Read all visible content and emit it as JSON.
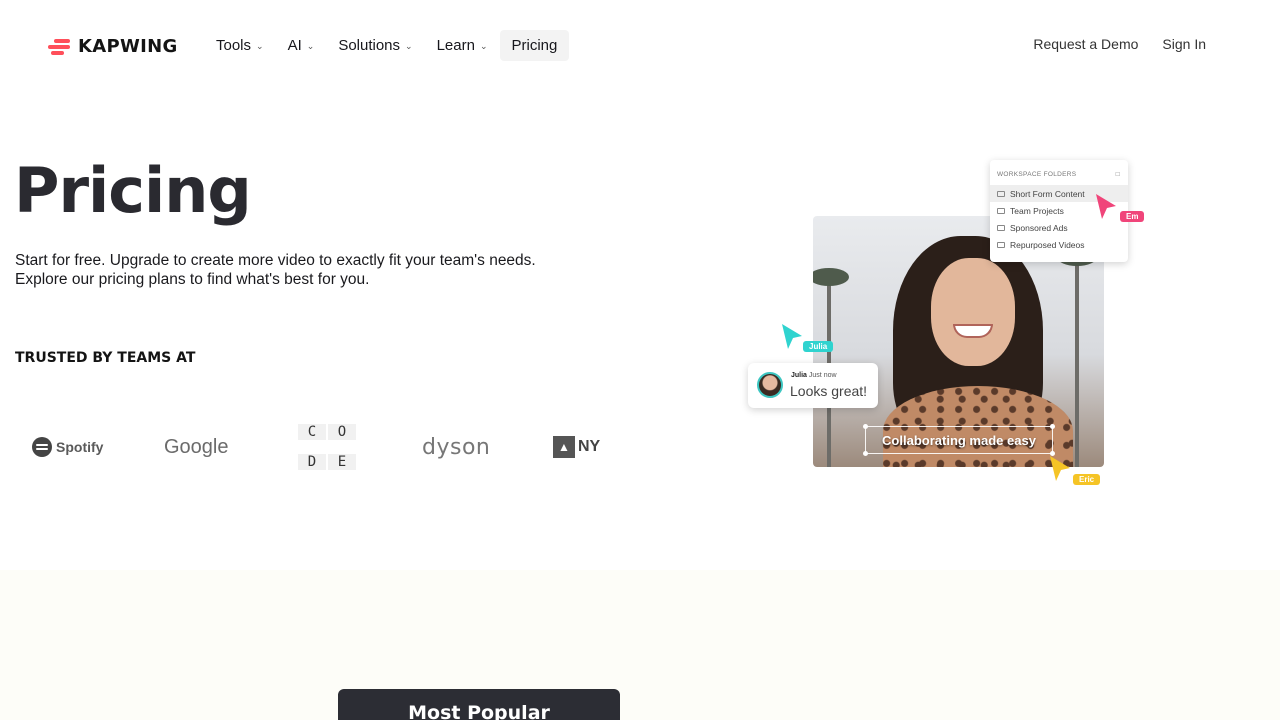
{
  "nav": {
    "brand": "KAPWING",
    "links": [
      {
        "label": "Tools",
        "dropdown": true
      },
      {
        "label": "AI",
        "dropdown": true
      },
      {
        "label": "Solutions",
        "dropdown": true
      },
      {
        "label": "Learn",
        "dropdown": true
      },
      {
        "label": "Pricing",
        "dropdown": false
      }
    ],
    "request_demo": "Request a Demo",
    "sign_in": "Sign In"
  },
  "hero": {
    "title": "Pricing",
    "subtitle_line1": "Start for free. Upgrade to create more video to exactly fit your team's needs.",
    "subtitle_line2": "Explore our pricing plans to find what's best for you.",
    "trusted_label": "TRUSTED BY TEAMS AT"
  },
  "trusted_logos": {
    "spotify": "Spotify",
    "google": "Google",
    "code": [
      "C",
      "O",
      "D",
      "E"
    ],
    "dyson": "dyson",
    "nyt": "NY"
  },
  "illustration": {
    "folders_header": "WORKSPACE FOLDERS",
    "folders": [
      "Short Form Content",
      "Team Projects",
      "Sponsored Ads",
      "Repurposed Videos"
    ],
    "selected_folder": "Short Form Content",
    "cursor_em": "Em",
    "cursor_julia": "Julia",
    "cursor_eric": "Eric",
    "comment_author": "Julia",
    "comment_time": "Just now",
    "comment_text": "Looks great!",
    "caption": "Collaborating made easy",
    "colors": {
      "em": "#f0457a",
      "julia": "#2fd3cf",
      "eric": "#f5c426"
    }
  },
  "plans": {
    "badge": "Most Popular"
  }
}
